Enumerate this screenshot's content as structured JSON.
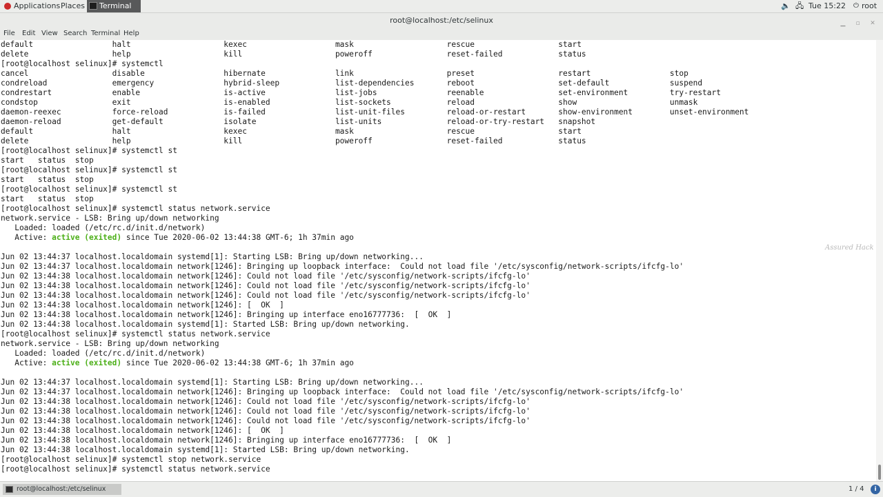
{
  "top_panel": {
    "applications_label": "Applications",
    "places_label": "Places",
    "taskbar_window_label": "Terminal",
    "clock": "Tue 15:22",
    "user": "root"
  },
  "window": {
    "title": "root@localhost:/etc/selinux"
  },
  "menubar": {
    "file": "File",
    "edit": "Edit",
    "view": "View",
    "search": "Search",
    "terminal": "Terminal",
    "help": "Help"
  },
  "terminal": {
    "lines": [
      "default                 halt                    kexec                   mask                    rescue                  start",
      "delete                  help                    kill                    poweroff                reset-failed            status",
      "[root@localhost selinux]# systemctl",
      "cancel                  disable                 hibernate               link                    preset                  restart                 stop",
      "condreload              emergency               hybrid-sleep            list-dependencies       reboot                  set-default             suspend",
      "condrestart             enable                  is-active               list-jobs               reenable                set-environment         try-restart",
      "condstop                exit                    is-enabled              list-sockets            reload                  show                    unmask",
      "daemon-reexec           force-reload            is-failed               list-unit-files         reload-or-restart       show-environment        unset-environment",
      "daemon-reload           get-default             isolate                 list-units              reload-or-try-restart   snapshot",
      "default                 halt                    kexec                   mask                    rescue                  start",
      "delete                  help                    kill                    poweroff                reset-failed            status",
      "[root@localhost selinux]# systemctl st",
      "start   status  stop",
      "[root@localhost selinux]# systemctl st",
      "start   status  stop",
      "[root@localhost selinux]# systemctl st",
      "start   status  stop",
      "[root@localhost selinux]# systemctl status network.service",
      "network.service - LSB: Bring up/down networking",
      "   Loaded: loaded (/etc/rc.d/init.d/network)",
      "   Active: ",
      "",
      "Jun 02 13:44:37 localhost.localdomain systemd[1]: Starting LSB: Bring up/down networking...",
      "Jun 02 13:44:37 localhost.localdomain network[1246]: Bringing up loopback interface:  Could not load file '/etc/sysconfig/network-scripts/ifcfg-lo'",
      "Jun 02 13:44:38 localhost.localdomain network[1246]: Could not load file '/etc/sysconfig/network-scripts/ifcfg-lo'",
      "Jun 02 13:44:38 localhost.localdomain network[1246]: Could not load file '/etc/sysconfig/network-scripts/ifcfg-lo'",
      "Jun 02 13:44:38 localhost.localdomain network[1246]: Could not load file '/etc/sysconfig/network-scripts/ifcfg-lo'",
      "Jun 02 13:44:38 localhost.localdomain network[1246]: [  OK  ]",
      "Jun 02 13:44:38 localhost.localdomain network[1246]: Bringing up interface eno16777736:  [  OK  ]",
      "Jun 02 13:44:38 localhost.localdomain systemd[1]: Started LSB: Bring up/down networking.",
      "[root@localhost selinux]# systemctl status network.service",
      "network.service - LSB: Bring up/down networking",
      "   Loaded: loaded (/etc/rc.d/init.d/network)",
      "   Active: ",
      "",
      "Jun 02 13:44:37 localhost.localdomain systemd[1]: Starting LSB: Bring up/down networking...",
      "Jun 02 13:44:37 localhost.localdomain network[1246]: Bringing up loopback interface:  Could not load file '/etc/sysconfig/network-scripts/ifcfg-lo'",
      "Jun 02 13:44:38 localhost.localdomain network[1246]: Could not load file '/etc/sysconfig/network-scripts/ifcfg-lo'",
      "Jun 02 13:44:38 localhost.localdomain network[1246]: Could not load file '/etc/sysconfig/network-scripts/ifcfg-lo'",
      "Jun 02 13:44:38 localhost.localdomain network[1246]: Could not load file '/etc/sysconfig/network-scripts/ifcfg-lo'",
      "Jun 02 13:44:38 localhost.localdomain network[1246]: [  OK  ]",
      "Jun 02 13:44:38 localhost.localdomain network[1246]: Bringing up interface eno16777736:  [  OK  ]",
      "Jun 02 13:44:38 localhost.localdomain systemd[1]: Started LSB: Bring up/down networking.",
      "[root@localhost selinux]# systemctl stop network.service",
      "[root@localhost selinux]# systemctl status network.service "
    ],
    "active_status": "active (exited)",
    "active_since": " since Tue 2020-06-02 13:44:38 GMT-6; 1h 37min ago",
    "active_line_indices": [
      20,
      33
    ],
    "cursor_line_index": 45,
    "status_color": "#4caf18"
  },
  "watermark": "Assured Hack",
  "bottom_panel": {
    "task_label": "root@localhost:/etc/selinux",
    "workspace": "1 / 4"
  }
}
